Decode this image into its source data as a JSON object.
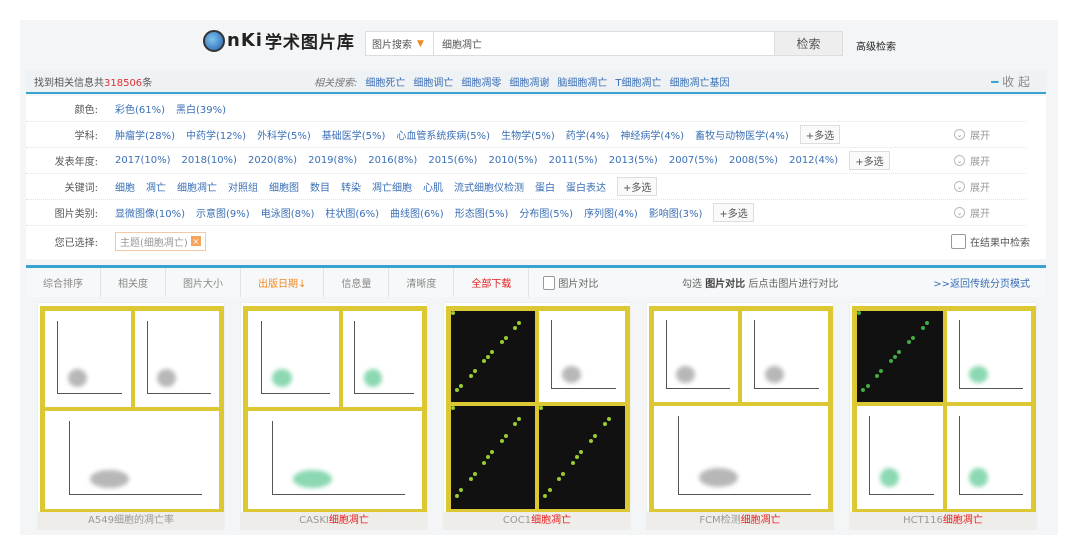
{
  "header": {
    "logo_text": "学术图片库",
    "search_type": "图片搜索",
    "search_value": "细胞凋亡",
    "search_button": "检索",
    "advanced": "高级检索"
  },
  "info": {
    "prefix": "找到相关信息共",
    "count": "318506",
    "suffix": "条",
    "related_label": "相关搜索:",
    "related": [
      "细胞死亡",
      "细胞调亡",
      "细胞凋零",
      "细胞凋谢",
      "脑细胞凋亡",
      "T细胞凋亡",
      "细胞凋亡基因"
    ],
    "collapse": "收 起"
  },
  "filters": [
    {
      "label": "颜色:",
      "values": [
        "彩色(61%)",
        "黑白(39%)"
      ]
    },
    {
      "label": "学科:",
      "values": [
        "肿瘤学(28%)",
        "中药学(12%)",
        "外科学(5%)",
        "基础医学(5%)",
        "心血管系统疾病(5%)",
        "生物学(5%)",
        "药学(4%)",
        "神经病学(4%)",
        "畜牧与动物医学(4%)"
      ],
      "more": "+多选",
      "expand": "展开"
    },
    {
      "label": "发表年度:",
      "values": [
        "2017(10%)",
        "2018(10%)",
        "2020(8%)",
        "2019(8%)",
        "2016(8%)",
        "2015(6%)",
        "2010(5%)",
        "2011(5%)",
        "2013(5%)",
        "2007(5%)",
        "2008(5%)",
        "2012(4%)"
      ],
      "more": "+多选",
      "expand": "展开"
    },
    {
      "label": "关键词:",
      "values": [
        "细胞",
        "凋亡",
        "细胞凋亡",
        "对照组",
        "细胞图",
        "数目",
        "转染",
        "凋亡细胞",
        "心肌",
        "流式细胞仪检测",
        "蛋白",
        "蛋白表达"
      ],
      "more": "+多选",
      "expand": "展开"
    },
    {
      "label": "图片类别:",
      "values": [
        "显微图像(10%)",
        "示意图(9%)",
        "电泳图(8%)",
        "柱状图(6%)",
        "曲线图(6%)",
        "形态图(5%)",
        "分布图(5%)",
        "序列图(4%)",
        "影响图(3%)"
      ],
      "more": "+多选",
      "expand": "展开"
    }
  ],
  "selected": {
    "label": "您已选择:",
    "tag": "主题(细胞凋亡)",
    "close": "×",
    "search_in_results": "在结果中检索"
  },
  "sort": {
    "items": [
      "综合排序",
      "相关度",
      "图片大小",
      "出版日期↓",
      "信息量",
      "清晰度"
    ],
    "download_all": "全部下载",
    "compare": "图片对比",
    "hint_pre": "勾选",
    "hint_bold": "图片对比",
    "hint_post": "后点击图片进行对比",
    "back": ">>返回传统分页模式"
  },
  "results": [
    {
      "pre": "A549细胞的凋亡率",
      "hl": ""
    },
    {
      "pre": "CASKI",
      "hl": "细胞凋亡"
    },
    {
      "pre": "COC1",
      "hl": "细胞凋亡"
    },
    {
      "pre": "FCM检测",
      "hl": "细胞凋亡"
    },
    {
      "pre": "HCT116",
      "hl": "细胞凋亡"
    }
  ],
  "colors": {
    "accent": "#38a3d1",
    "link": "#3a6fb6",
    "highlight": "#e82020",
    "orange": "#f08a24",
    "thumb_border": "#dcc832"
  }
}
